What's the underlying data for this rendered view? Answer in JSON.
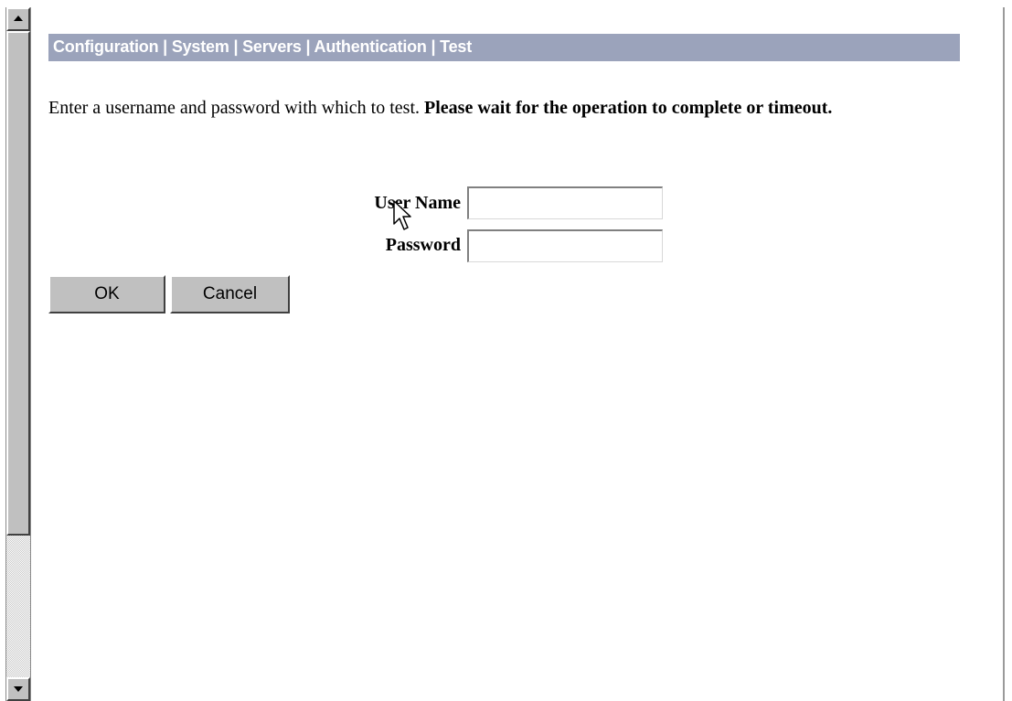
{
  "breadcrumb": {
    "path": "Configuration | System | Servers | Authentication | Test"
  },
  "instructions": {
    "text": "Enter a username and password with which to test.",
    "emphasis": "Please wait for the operation to complete or timeout."
  },
  "form": {
    "username_label": "User Name",
    "username_value": "",
    "password_label": "Password",
    "password_value": ""
  },
  "buttons": {
    "ok_label": "OK",
    "cancel_label": "Cancel"
  },
  "colors": {
    "breadcrumb_bg": "#9ba3bb",
    "breadcrumb_text": "#ffffff",
    "button_face": "#c0c0c0"
  },
  "icons": {
    "scroll_up": "arrow-up-icon",
    "scroll_down": "arrow-down-icon",
    "cursor": "mouse-pointer-icon"
  }
}
